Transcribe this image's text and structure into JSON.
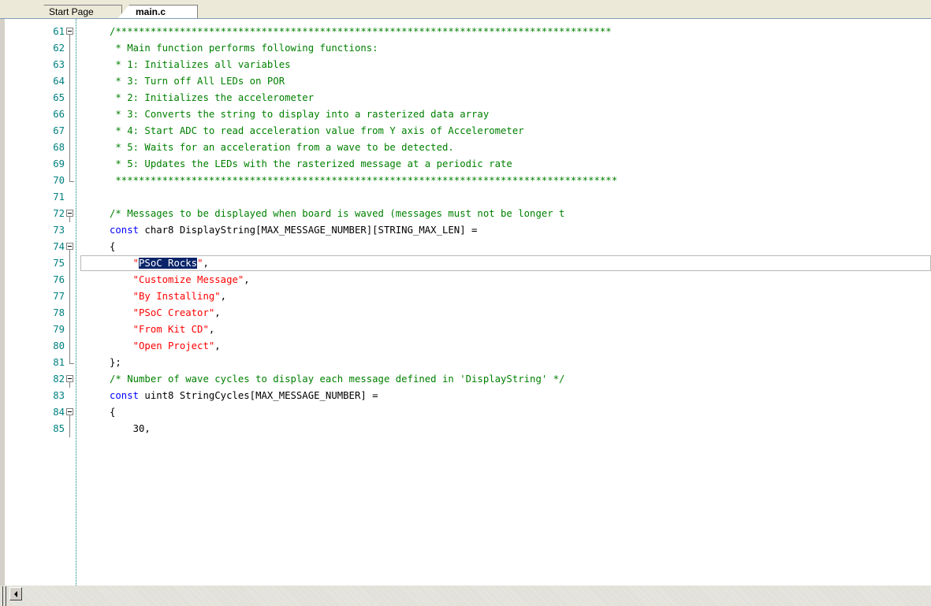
{
  "tabs": [
    {
      "label": "Start Page",
      "active": false
    },
    {
      "label": "main.c",
      "active": true
    }
  ],
  "editor": {
    "current_line": 75,
    "selection_text": "PSoC Rocks",
    "lines": [
      {
        "num": "61",
        "fold": "open",
        "tokens": [
          {
            "t": "/*************************************************************************************",
            "c": "com"
          }
        ]
      },
      {
        "num": "62",
        "fold": "line",
        "tokens": [
          {
            "t": " * Main function performs following functions:",
            "c": "com"
          }
        ]
      },
      {
        "num": "63",
        "fold": "line",
        "tokens": [
          {
            "t": " * 1: Initializes all variables",
            "c": "com"
          }
        ]
      },
      {
        "num": "64",
        "fold": "line",
        "tokens": [
          {
            "t": " * 3: Turn off All LEDs on POR",
            "c": "com"
          }
        ]
      },
      {
        "num": "65",
        "fold": "line",
        "tokens": [
          {
            "t": " * 2: Initializes the accelerometer",
            "c": "com"
          }
        ]
      },
      {
        "num": "66",
        "fold": "line",
        "tokens": [
          {
            "t": " * 3: Converts the string to display into a rasterized data array",
            "c": "com"
          }
        ]
      },
      {
        "num": "67",
        "fold": "line",
        "tokens": [
          {
            "t": " * 4: Start ADC to read acceleration value from Y axis of Accelerometer",
            "c": "com"
          }
        ]
      },
      {
        "num": "68",
        "fold": "line",
        "tokens": [
          {
            "t": " * 5: Waits for an acceleration from a wave to be detected.",
            "c": "com"
          }
        ]
      },
      {
        "num": "69",
        "fold": "line",
        "tokens": [
          {
            "t": " * 5: Updates the LEDs with the rasterized message at a periodic rate",
            "c": "com"
          }
        ]
      },
      {
        "num": "70",
        "fold": "end",
        "tokens": [
          {
            "t": " **************************************************************************************",
            "c": "com"
          }
        ]
      },
      {
        "num": "71",
        "fold": "none",
        "tokens": []
      },
      {
        "num": "72",
        "fold": "open",
        "tokens": [
          {
            "t": "/* Messages to be displayed when board is waved (messages must not be longer t",
            "c": "com"
          }
        ]
      },
      {
        "num": "73",
        "fold": "none",
        "tokens": [
          {
            "t": "const ",
            "c": "kw"
          },
          {
            "t": "char8 DisplayString[MAX_MESSAGE_NUMBER][STRING_MAX_LEN] =",
            "c": "plain"
          }
        ]
      },
      {
        "num": "74",
        "fold": "open",
        "tokens": [
          {
            "t": "{",
            "c": "plain"
          }
        ]
      },
      {
        "num": "75",
        "fold": "line",
        "tokens": [
          {
            "t": "    \"",
            "c": "str"
          },
          {
            "t": "PSoC Rocks",
            "c": "sel"
          },
          {
            "t": "\"",
            "c": "str"
          },
          {
            "t": ",",
            "c": "plain"
          }
        ]
      },
      {
        "num": "76",
        "fold": "line",
        "tokens": [
          {
            "t": "    \"Customize Message\"",
            "c": "str"
          },
          {
            "t": ",",
            "c": "plain"
          }
        ]
      },
      {
        "num": "77",
        "fold": "line",
        "tokens": [
          {
            "t": "    \"By Installing\"",
            "c": "str"
          },
          {
            "t": ",",
            "c": "plain"
          }
        ]
      },
      {
        "num": "78",
        "fold": "line",
        "tokens": [
          {
            "t": "    \"PSoC Creator\"",
            "c": "str"
          },
          {
            "t": ",",
            "c": "plain"
          }
        ]
      },
      {
        "num": "79",
        "fold": "line",
        "tokens": [
          {
            "t": "    \"From Kit CD\"",
            "c": "str"
          },
          {
            "t": ",",
            "c": "plain"
          }
        ]
      },
      {
        "num": "80",
        "fold": "line",
        "tokens": [
          {
            "t": "    \"Open Project\"",
            "c": "str"
          },
          {
            "t": ",",
            "c": "plain"
          }
        ]
      },
      {
        "num": "81",
        "fold": "end",
        "tokens": [
          {
            "t": "};",
            "c": "plain"
          }
        ]
      },
      {
        "num": "82",
        "fold": "open",
        "tokens": [
          {
            "t": "/* Number of wave cycles to display each message defined in 'DisplayString' */",
            "c": "com"
          }
        ]
      },
      {
        "num": "83",
        "fold": "none",
        "tokens": [
          {
            "t": "const ",
            "c": "kw"
          },
          {
            "t": "uint8 StringCycles[MAX_MESSAGE_NUMBER] =",
            "c": "plain"
          }
        ]
      },
      {
        "num": "84",
        "fold": "open",
        "tokens": [
          {
            "t": "{",
            "c": "plain"
          }
        ]
      },
      {
        "num": "85",
        "fold": "line",
        "tokens": [
          {
            "t": "    30,",
            "c": "plain"
          }
        ]
      }
    ]
  }
}
